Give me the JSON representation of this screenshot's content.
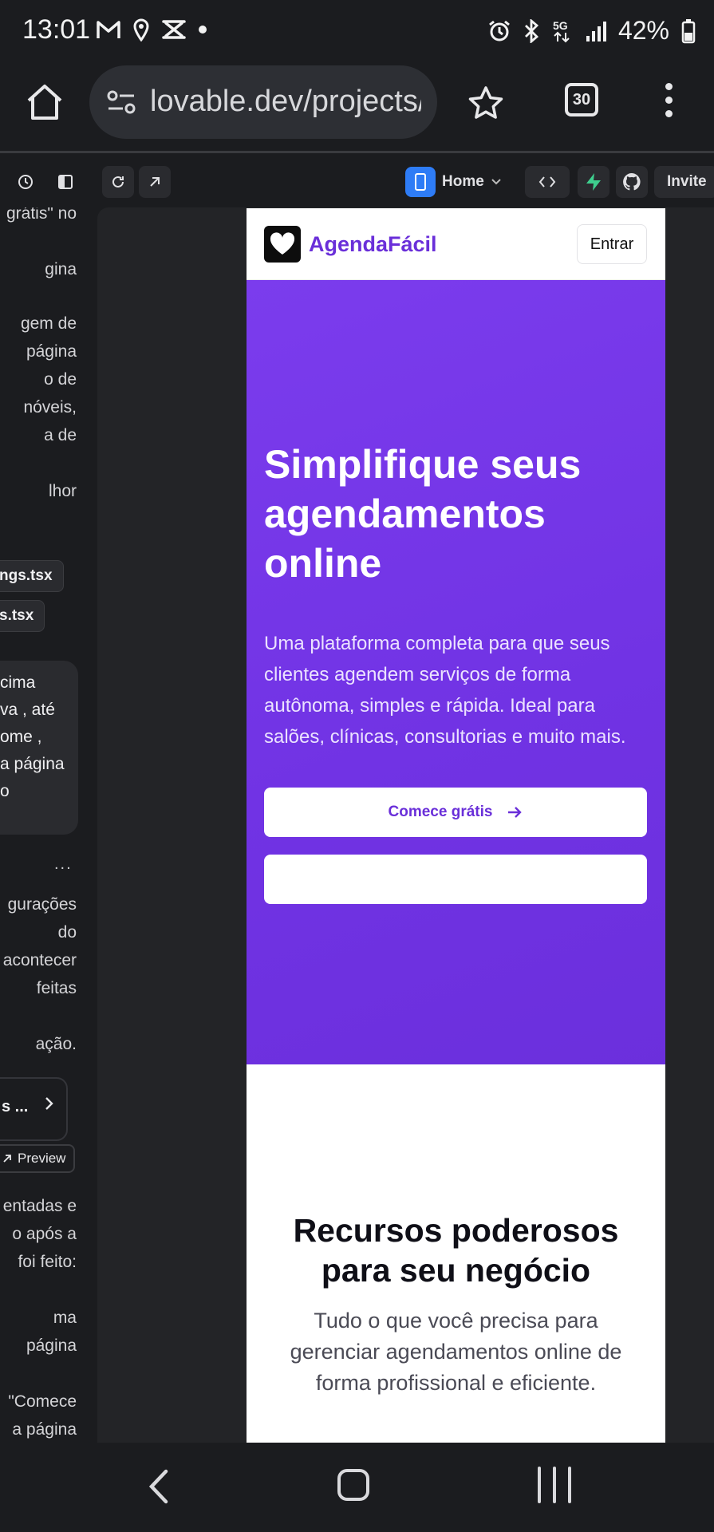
{
  "status_bar": {
    "time": "13:01",
    "left_icons": [
      "gmail-icon",
      "location-icon",
      "capcut-icon",
      "dot-icon"
    ],
    "right_icons": [
      "alarm-icon",
      "bluetooth-icon",
      "5g-icon",
      "signal-icon"
    ],
    "network": "5G",
    "battery": "42%"
  },
  "browser": {
    "url": "lovable.dev/projects/",
    "tab_count": "30"
  },
  "toolbar": {
    "home_label": "Home",
    "invite_label": "Invite"
  },
  "chat": {
    "lines_top": [
      "grátis\" no",
      "",
      "gina",
      "",
      "gem de",
      "página",
      "o de",
      "nóveis,",
      "a de",
      "",
      "lhor"
    ],
    "files": [
      "ngs.tsx",
      "s.tsx"
    ],
    "bubble_lines": [
      "cima",
      "va , até",
      "ome ,",
      "a página",
      "o"
    ],
    "dots": "...",
    "lines_mid": [
      "gurações",
      "do",
      "acontecer",
      "feitas",
      "",
      "ação."
    ],
    "card_text": "s ...",
    "preview_label": "Preview",
    "lines_bottom": [
      "entadas e",
      "o após a",
      "foi feito:",
      "",
      "ma",
      "página",
      "",
      "\"Comece",
      "a página"
    ]
  },
  "app": {
    "brand": "AgendaFácil",
    "login_button": "Entrar",
    "hero": {
      "title": "Simplifique seus agendamentos online",
      "subtitle": "Uma plataforma completa para que seus clientes agendem serviços de forma autônoma, simples e rápida. Ideal para salões, clínicas, consultorias e muito mais.",
      "cta_primary": "Comece grátis",
      "cta_secondary": ""
    },
    "features": {
      "title": "Recursos poderosos para seu negócio",
      "subtitle": "Tudo o que você precisa para gerenciar agendamentos online de forma profissional e eficiente."
    }
  },
  "colors": {
    "hero_purple": "#7436e6",
    "brand_purple": "#6a2fd9",
    "supabase_green": "#3ecf8e",
    "device_blue": "#2e7cf6"
  }
}
